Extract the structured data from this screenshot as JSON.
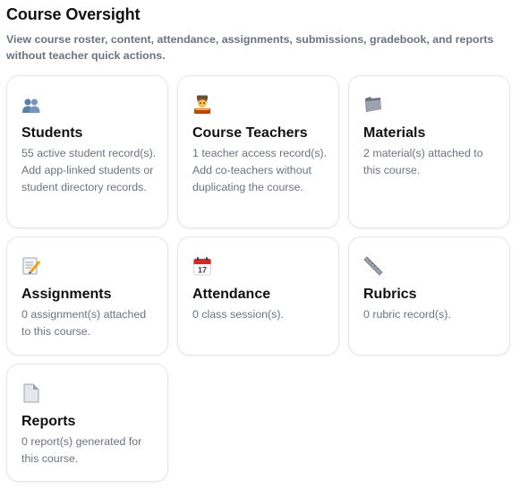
{
  "header": {
    "title": "Course Oversight",
    "subtitle": "View course roster, content, attendance, assignments, submissions, gradebook, and reports without teacher quick actions."
  },
  "cards": [
    {
      "icon": "students-icon",
      "title": "Students",
      "description": "55 active student record(s). Add app-linked students or student directory records."
    },
    {
      "icon": "teacher-icon",
      "title": "Course Teachers",
      "description": "1 teacher access record(s). Add co-teachers without duplicating the course."
    },
    {
      "icon": "folder-icon",
      "title": "Materials",
      "description": "2 material(s) attached to this course."
    },
    {
      "icon": "memo-icon",
      "title": "Assignments",
      "description": "0 assignment(s) attached to this course."
    },
    {
      "icon": "calendar-icon",
      "title": "Attendance",
      "description": "0 class session(s)."
    },
    {
      "icon": "ruler-icon",
      "title": "Rubrics",
      "description": "0 rubric record(s)."
    },
    {
      "icon": "document-icon",
      "title": "Reports",
      "description": "0 report(s) generated for this course."
    }
  ],
  "calendar_icon_day": "17"
}
